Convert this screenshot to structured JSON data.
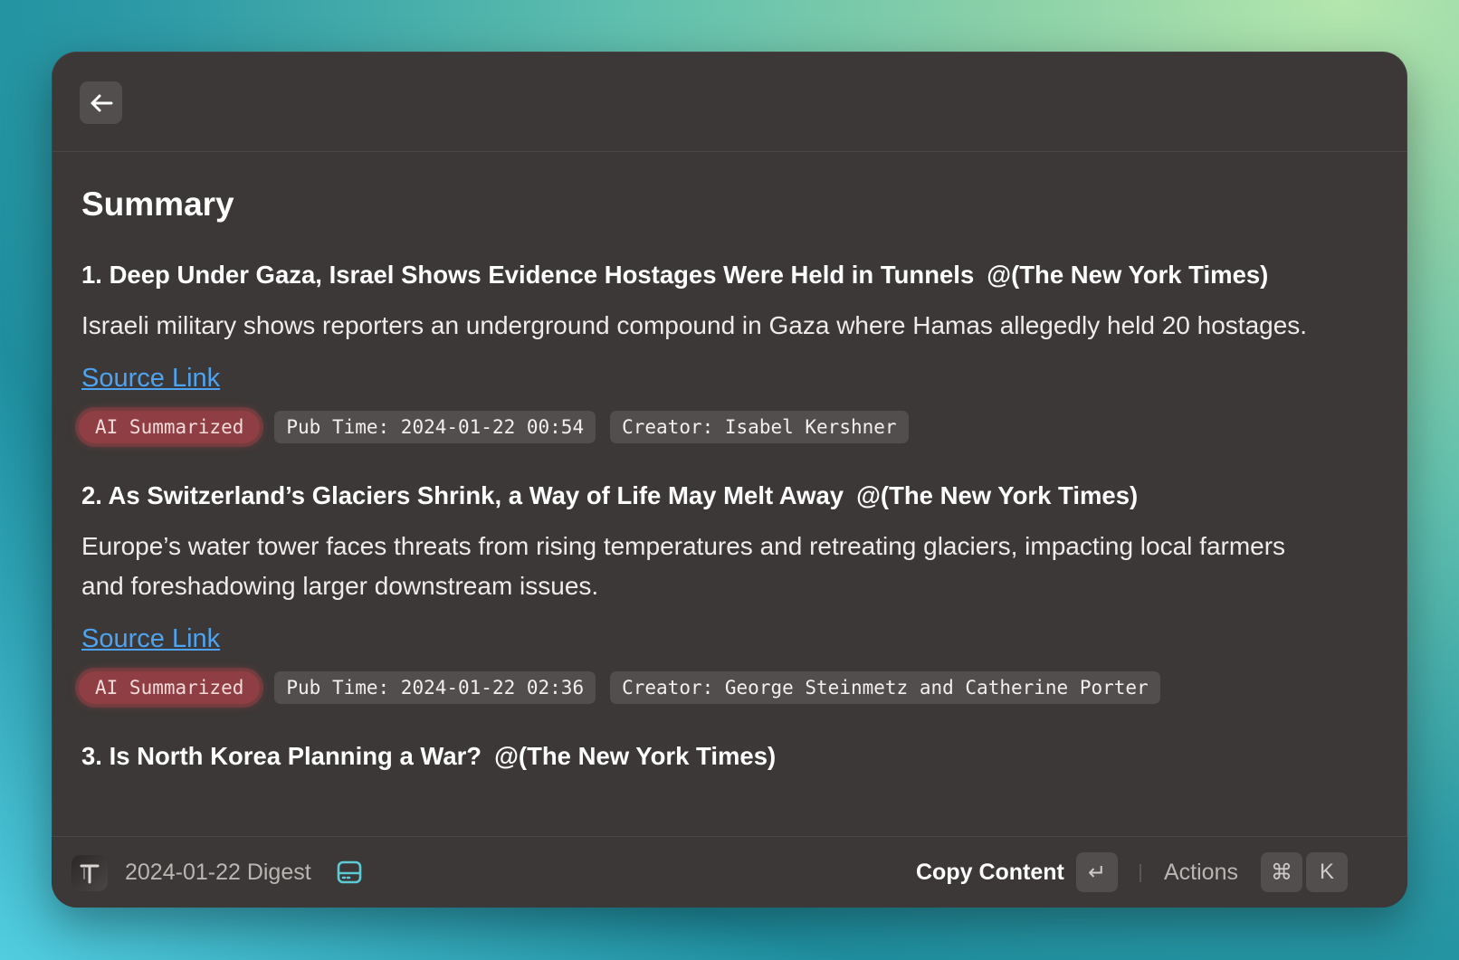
{
  "page": {
    "title": "Summary"
  },
  "items": [
    {
      "title": "1. Deep Under Gaza, Israel Shows Evidence Hostages Were Held in Tunnels",
      "source": "@(The New York Times)",
      "description": "Israeli military shows reporters an underground compound in Gaza where Hamas allegedly held 20 hostages.",
      "link_label": "Source Link",
      "ai_tag": "AI Summarized",
      "pub_time": "Pub Time: 2024-01-22 00:54",
      "creator": "Creator: Isabel Kershner"
    },
    {
      "title": "2. As Switzerland’s Glaciers Shrink, a Way of Life May Melt Away",
      "source": "@(The New York Times)",
      "description": "Europe’s water tower faces threats from rising temperatures and retreating glaciers, impacting local farmers and foreshadowing larger downstream issues.",
      "link_label": "Source Link",
      "ai_tag": "AI Summarized",
      "pub_time": "Pub Time: 2024-01-22 02:36",
      "creator": "Creator: George Steinmetz and Catherine Porter"
    },
    {
      "title": "3. Is North Korea Planning a War?",
      "source": "@(The New York Times)"
    }
  ],
  "footer": {
    "title": "2024-01-22 Digest",
    "primary_action": "Copy Content",
    "primary_shortcut": "↵",
    "actions_label": "Actions",
    "actions_shortcut_mod": "⌘",
    "actions_shortcut_key": "K"
  },
  "icons": {
    "back": "arrow-left-icon",
    "app": "app-logo-icon",
    "drive": "hard-drive-icon"
  },
  "colors": {
    "window_bg": "#3b3837",
    "link": "#4da3f0",
    "ai_tag_bg": "#8f3f43",
    "tag_bg": "#514e4d",
    "drive_icon": "#5ccbd6"
  }
}
